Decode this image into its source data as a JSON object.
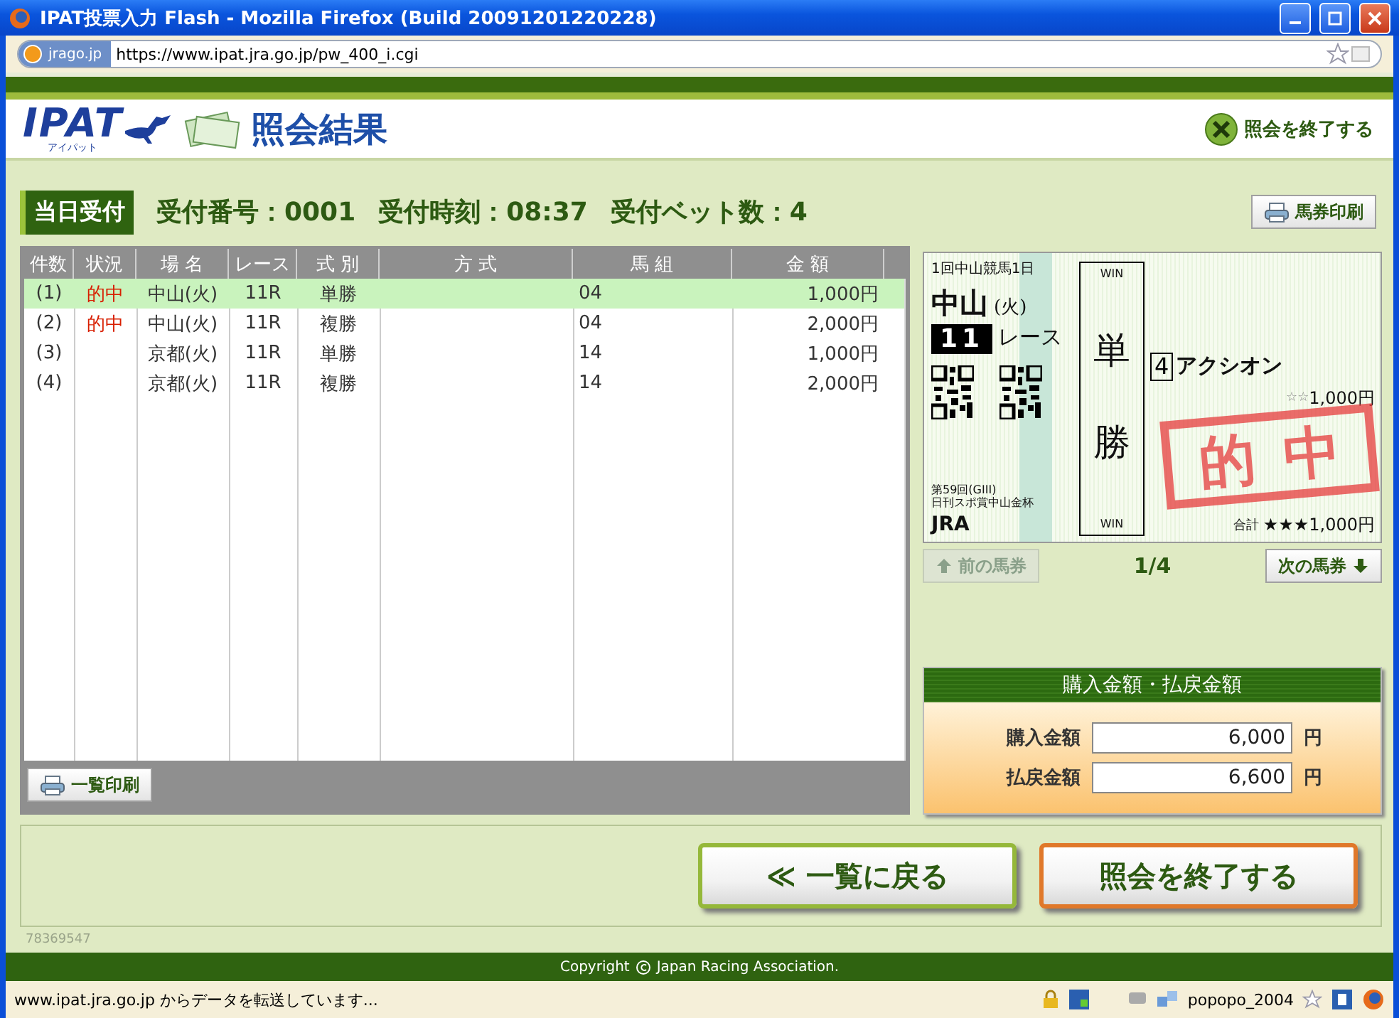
{
  "window": {
    "title": "IPAT投票入力 Flash - Mozilla Firefox (Build 20091201220228)"
  },
  "address_bar": {
    "site": "jrago.jp",
    "url": "https://www.ipat.jra.go.jp/pw_400_i.cgi"
  },
  "header": {
    "logo": "IPAT",
    "logo_sub": "アイパット",
    "title": "照会結果",
    "exit_link": "照会を終了する"
  },
  "receipt": {
    "badge": "当日受付",
    "number": "受付番号：0001",
    "time": "受付時刻：08:37",
    "bet_count": "受付ベット数：4",
    "ticket_print": "馬券印刷"
  },
  "table": {
    "columns": [
      "件数",
      "状況",
      "場 名",
      "レース",
      "式 別",
      "方 式",
      "馬 組",
      "金 額"
    ],
    "rows": [
      {
        "count": "(1)",
        "status": "的中",
        "venue": "中山(火)",
        "race": "11R",
        "type": "単勝",
        "horses": "04",
        "amount": "1,000円",
        "selected": true
      },
      {
        "count": "(2)",
        "status": "的中",
        "venue": "中山(火)",
        "race": "11R",
        "type": "複勝",
        "horses": "04",
        "amount": "2,000円",
        "selected": false
      },
      {
        "count": "(3)",
        "venue": "京都(火)",
        "race": "11R",
        "type": "単勝",
        "horses": "14",
        "amount": "1,000円",
        "selected": false
      },
      {
        "count": "(4)",
        "venue": "京都(火)",
        "race": "11R",
        "type": "複勝",
        "horses": "14",
        "amount": "2,000円",
        "selected": false
      }
    ],
    "print_button": "一覧印刷"
  },
  "ticket": {
    "meeting": "1回中山競馬1日",
    "venue": "中山",
    "day": "(火)",
    "race_no": "11",
    "race_label": "レース",
    "win_top": "WIN",
    "type_1": "単",
    "type_2": "勝",
    "win_bottom": "WIN",
    "horse_no": "4",
    "horse_name": "アクシオン",
    "stars": "☆☆",
    "amount": "1,000円",
    "race_name_1": "第59回(GIII)",
    "race_name_2": "日刊スポ賞中山金杯",
    "org": "JRA",
    "total_label": "合計",
    "total": "★★★1,000円",
    "stamp": "的中"
  },
  "ticket_nav": {
    "prev": "前の馬券",
    "prev_disabled": true,
    "page": "1/4",
    "next": "次の馬券",
    "next_disabled": false
  },
  "summary": {
    "title": "購入金額・払戻金額",
    "rows": [
      {
        "label": "購入金額",
        "value": "6,000",
        "unit": "円"
      },
      {
        "label": "払戻金額",
        "value": "6,600",
        "unit": "円"
      }
    ]
  },
  "actions": {
    "back": "≪ 一覧に戻る",
    "exit": "照会を終了する"
  },
  "page_id": "78369547",
  "footer": "Copyright",
  "footer_rest": "Japan Racing Association.",
  "status_bar": {
    "message": "www.ipat.jra.go.jp からデータを転送しています...",
    "user": "popopo_2004"
  }
}
